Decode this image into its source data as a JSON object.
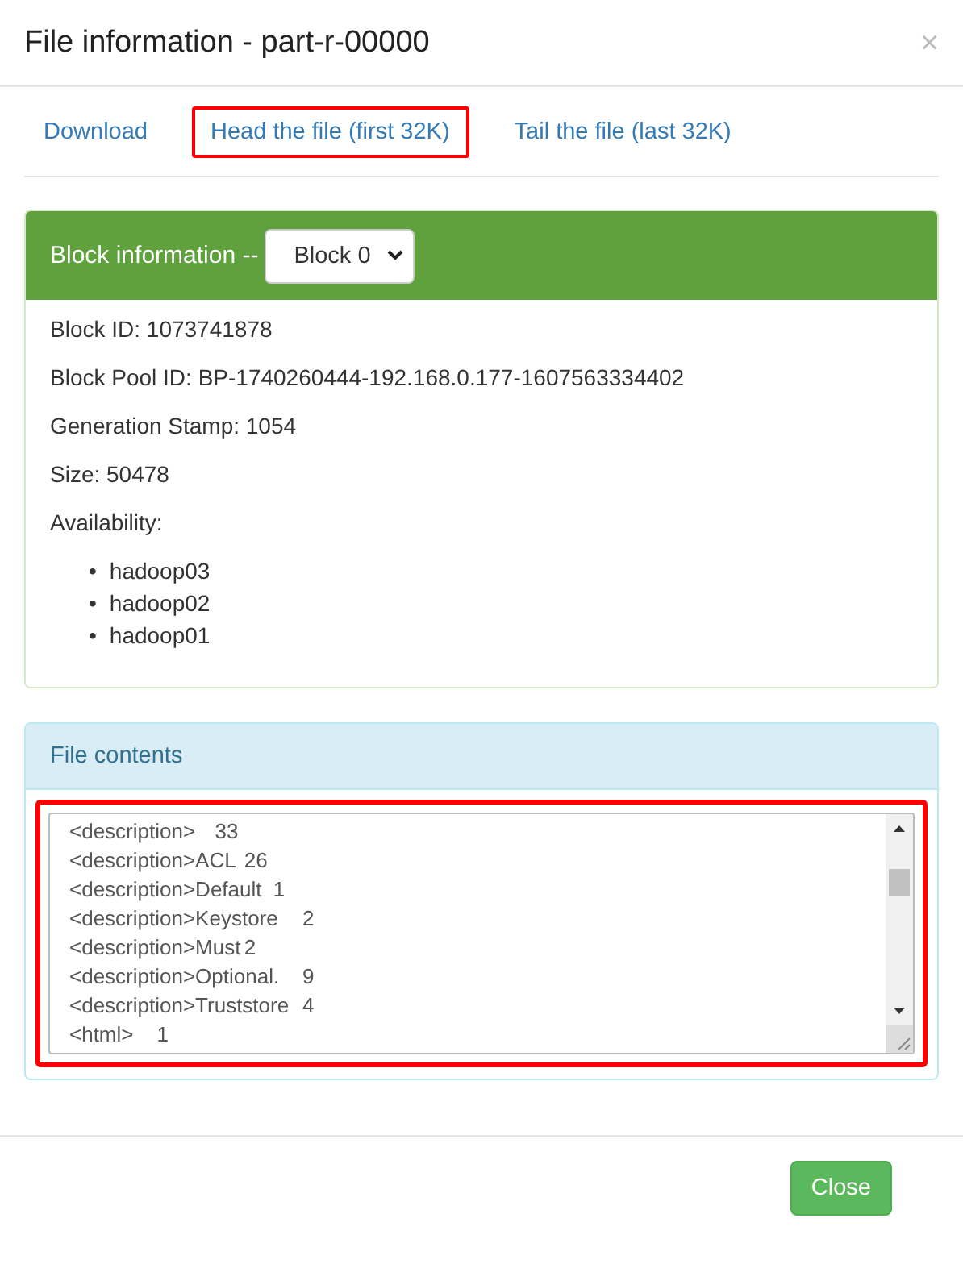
{
  "dialog": {
    "title": "File information - part-r-00000",
    "close_icon": "×"
  },
  "links": [
    {
      "label": "Download",
      "highlighted": false
    },
    {
      "label": "Head the file (first 32K)",
      "highlighted": true
    },
    {
      "label": "Tail the file (last 32K)",
      "highlighted": false
    }
  ],
  "block_panel": {
    "heading": "Block information --",
    "block_select": "Block 0",
    "fields": [
      "Block ID: 1073741878",
      "Block Pool ID: BP-1740260444-192.168.0.177-1607563334402",
      "Generation Stamp: 1054",
      "Size: 50478",
      "Availability:"
    ],
    "availability": [
      {
        "bullet": "•",
        "host": "hadoop03"
      },
      {
        "bullet": "•",
        "host": "hadoop02"
      },
      {
        "bullet": "•",
        "host": "hadoop01"
      }
    ]
  },
  "contents_panel": {
    "heading": "File contents",
    "highlighted": true,
    "lines": [
      "<description>\t33",
      "<description>ACL\t26",
      "<description>Default\t1",
      "<description>Keystore\t2",
      "<description>Must\t2",
      "<description>Optional.\t9",
      "<description>Truststore\t4",
      "<html>\t1"
    ]
  },
  "footer": {
    "close_button": "Close"
  }
}
